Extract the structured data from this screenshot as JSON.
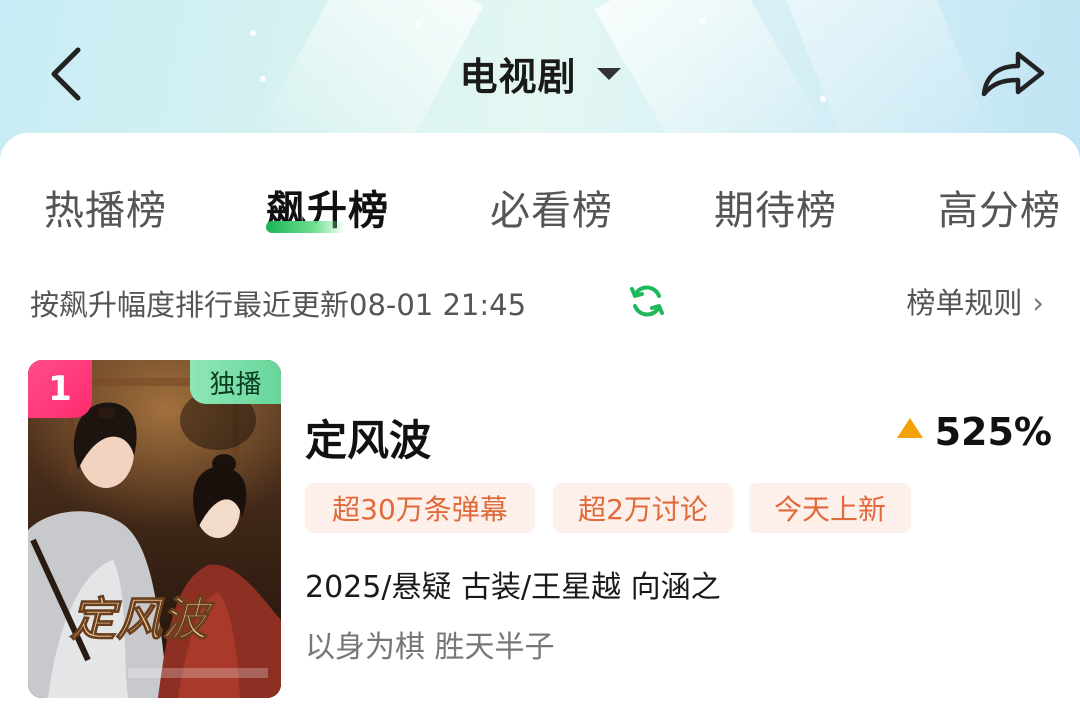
{
  "header": {
    "title": "电视剧"
  },
  "tabs": [
    {
      "label": "热播榜",
      "active": false
    },
    {
      "label": "飙升榜",
      "active": true
    },
    {
      "label": "必看榜",
      "active": false
    },
    {
      "label": "期待榜",
      "active": false
    },
    {
      "label": "高分榜",
      "active": false
    }
  ],
  "subbar": {
    "sort_text": "按飙升幅度排行最近更新08-01 21:45",
    "rules_label": "榜单规则"
  },
  "list": [
    {
      "rank": "1",
      "badge": "独播",
      "poster_text": "定风波",
      "title": "定风波",
      "rise": "525%",
      "chips": [
        "超30万条弹幕",
        "超2万讨论",
        "今天上新"
      ],
      "meta": "2025/悬疑 古装/王星越 向涵之",
      "tagline": "以身为棋 胜天半子"
    }
  ],
  "colors": {
    "accent_green": "#19b455",
    "rise_arrow": "#f5a20a",
    "chip_text": "#e06a3a",
    "chip_bg": "#fdf0eb",
    "rank_pink": "#ff2a6d"
  }
}
